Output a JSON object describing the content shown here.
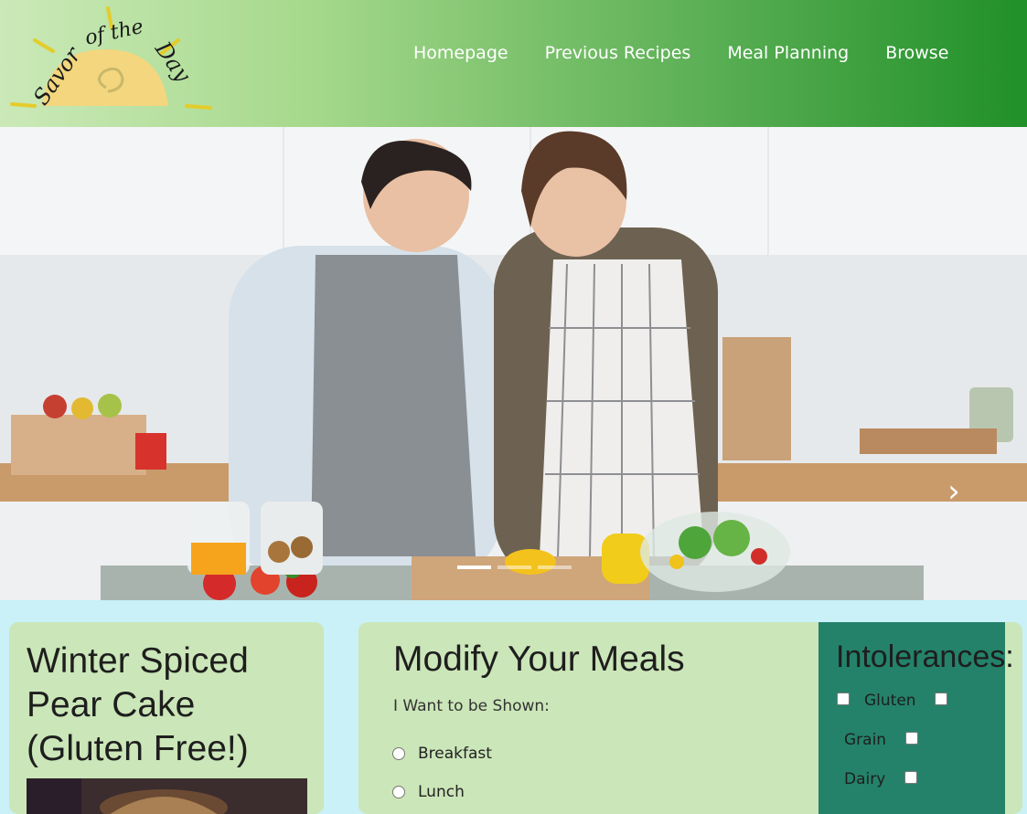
{
  "logo": {
    "text": "Savor of the Day"
  },
  "nav": [
    {
      "label": "Homepage"
    },
    {
      "label": "Previous Recipes"
    },
    {
      "label": "Meal Planning"
    },
    {
      "label": "Browse"
    }
  ],
  "hero": {
    "next_icon": "chevron-right-icon",
    "active_slide": 1,
    "slide_count": 3
  },
  "recipe": {
    "title": "Winter Spiced Pear Cake (Gluten Free!)"
  },
  "modify": {
    "title": "Modify Your Meals",
    "subtitle": "I Want to be Shown:",
    "options": [
      {
        "label": "Breakfast"
      },
      {
        "label": "Lunch"
      }
    ]
  },
  "intolerances": {
    "title": "Intolerances:",
    "items": [
      {
        "label": "Gluten"
      },
      {
        "label": "Grain"
      },
      {
        "label": "Dairy"
      }
    ]
  },
  "colors": {
    "header_dark": "#209028",
    "panel": "#cbe6b8",
    "intol_bg": "#24826a",
    "page_bg": "#c9f1f7"
  }
}
